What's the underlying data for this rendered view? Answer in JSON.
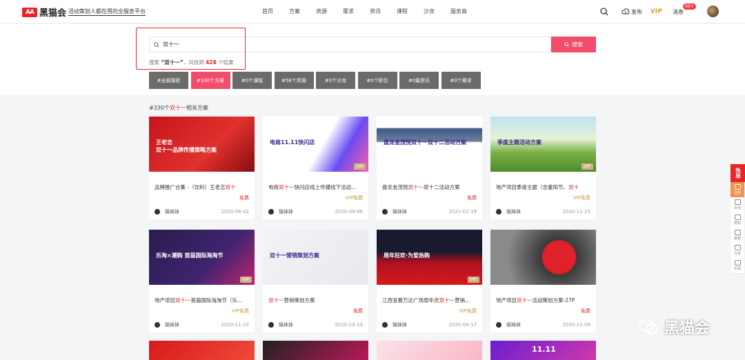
{
  "header": {
    "logo_mark": "AA",
    "logo_name": "黑猫会",
    "slogan": "活动策划人都在用的全服务平台",
    "nav": [
      "首页",
      "方案",
      "资源",
      "需求",
      "资讯",
      "课程",
      "沙龙",
      "服务商"
    ],
    "publish_label": "发布",
    "vip_label": "VIP",
    "message_label": "消息",
    "message_badge": "99+"
  },
  "search": {
    "value": "双十一",
    "button_label": "搜索",
    "result_prefix": "搜索",
    "result_keyword": "“双十一”",
    "result_mid": "，共找到",
    "result_count": "428",
    "result_suffix": "个结果"
  },
  "filters": [
    {
      "label": "#全部搜索",
      "active": false
    },
    {
      "label": "#330个方案",
      "active": true
    },
    {
      "label": "#0个课程",
      "active": false
    },
    {
      "label": "#58个资源",
      "active": false
    },
    {
      "label": "#0个沙龙",
      "active": false
    },
    {
      "label": "#0个职位",
      "active": false
    },
    {
      "label": "#0篇资讯",
      "active": false
    },
    {
      "label": "#0个需求",
      "active": false
    }
  ],
  "section": {
    "prefix": "#330个",
    "keyword": "双十一",
    "suffix": "相关方案"
  },
  "cards": [
    {
      "pre": "品牌推广合集 -（饮料）王老吉",
      "kw": "双十",
      "post": "",
      "price": "免费",
      "vip": false,
      "author": "猫妹妹",
      "date": "2020-06-02",
      "thumb_text": "王老吉\n双十一品牌传播策略方案",
      "bg": "linear-gradient(135deg,#c8141a,#e0322f 60%,#8a0c10)"
    },
    {
      "pre": "电商",
      "kw": "双十一",
      "post": "快闪店线上传播线下活动...",
      "price": "VIP免费",
      "vip": true,
      "author": "猫妹妹",
      "date": "2020-09-08",
      "thumb_text": "电商11.11快闪店",
      "bg": "linear-gradient(120deg,#ffffff 55%,#6a4cf2 75%,#ff5fa2)"
    },
    {
      "pre": "盘龙金茂悦",
      "kw": "双十一",
      "post": "双十二活动方案",
      "price": "免费",
      "vip": false,
      "author": "猫妹妹",
      "date": "2021-01-19",
      "thumb_text": "盘龙金茂悦双十一双十二活动方案",
      "bg": "linear-gradient(180deg,#ffffff 20%,#3d5a86 22%,#6f7fa0 45%,#ffffff 47%)"
    },
    {
      "pre": "地产项目季度主题（含重阳节、",
      "kw": "双十",
      "post": "",
      "price": "VIP免费",
      "vip": true,
      "author": "猫妹妹",
      "date": "2020-11-23",
      "thumb_text": "季度主题活动方案",
      "bg": "linear-gradient(180deg,#bfe3f2 0%,#e6f1d6 40%,#7ab248 65%,#4e8a2c 100%)"
    },
    {
      "pre": "地产项目",
      "kw": "双十一",
      "post": "首届国际海淘节（乐...",
      "price": "VIP免费",
      "vip": true,
      "author": "猫妹妹",
      "date": "2020-11-23",
      "thumb_text": "乐淘×潮购 首届国际海淘节",
      "bg": "linear-gradient(135deg,#2a1c4e,#3f2470 60%,#c0246e)"
    },
    {
      "pre": "",
      "kw": "双十一",
      "post": "营销策划方案",
      "price": "免费",
      "vip": false,
      "author": "猫妹妹",
      "date": "2020-10-14",
      "thumb_text": "双十一营销策划方案",
      "bg": "linear-gradient(135deg,#f2f3f6,#e7e9ee)"
    },
    {
      "pre": "江西宜春万达广场周年庆",
      "kw": "双十一",
      "post": "营销...",
      "price": "VIP免费",
      "vip": true,
      "author": "猫妹妹",
      "date": "2020-04-17",
      "thumb_text": "周年狂欢·为爱热购",
      "bg": "linear-gradient(180deg,#1a1a2e 40%,#b01020 60%,#d8191c)"
    },
    {
      "pre": "地产项目",
      "kw": "双十一",
      "post": "活动策划方案-27P",
      "price": "免费",
      "vip": false,
      "author": "猫妹妹",
      "date": "2020-11-09",
      "thumb_text": "",
      "bg": "radial-gradient(circle at 65% 50%,#e0202a 22%,#3a3a3a 24%,#8a8a8a 70%)"
    }
  ],
  "partial_rows": [
    {
      "bg": "linear-gradient(135deg,#d8191c,#f24d3a)"
    },
    {
      "bg": "linear-gradient(135deg,#222,#c2185b)"
    },
    {
      "bg": "linear-gradient(135deg,#fbe3e8,#f9b3c4)"
    },
    {
      "bg": "linear-gradient(135deg,#6a1fd1,#d43aa8)",
      "text": "11.11"
    }
  ],
  "side_tools": {
    "top_label": "免单",
    "items": [
      "任务",
      "反馈",
      "帮助",
      "客服",
      "分享",
      "反馈"
    ]
  },
  "watermark": {
    "text": "黑猫会"
  },
  "colors": {
    "brand": "#e8262a",
    "accent": "#f24d6b",
    "vip_gold": "#d8a13a"
  }
}
